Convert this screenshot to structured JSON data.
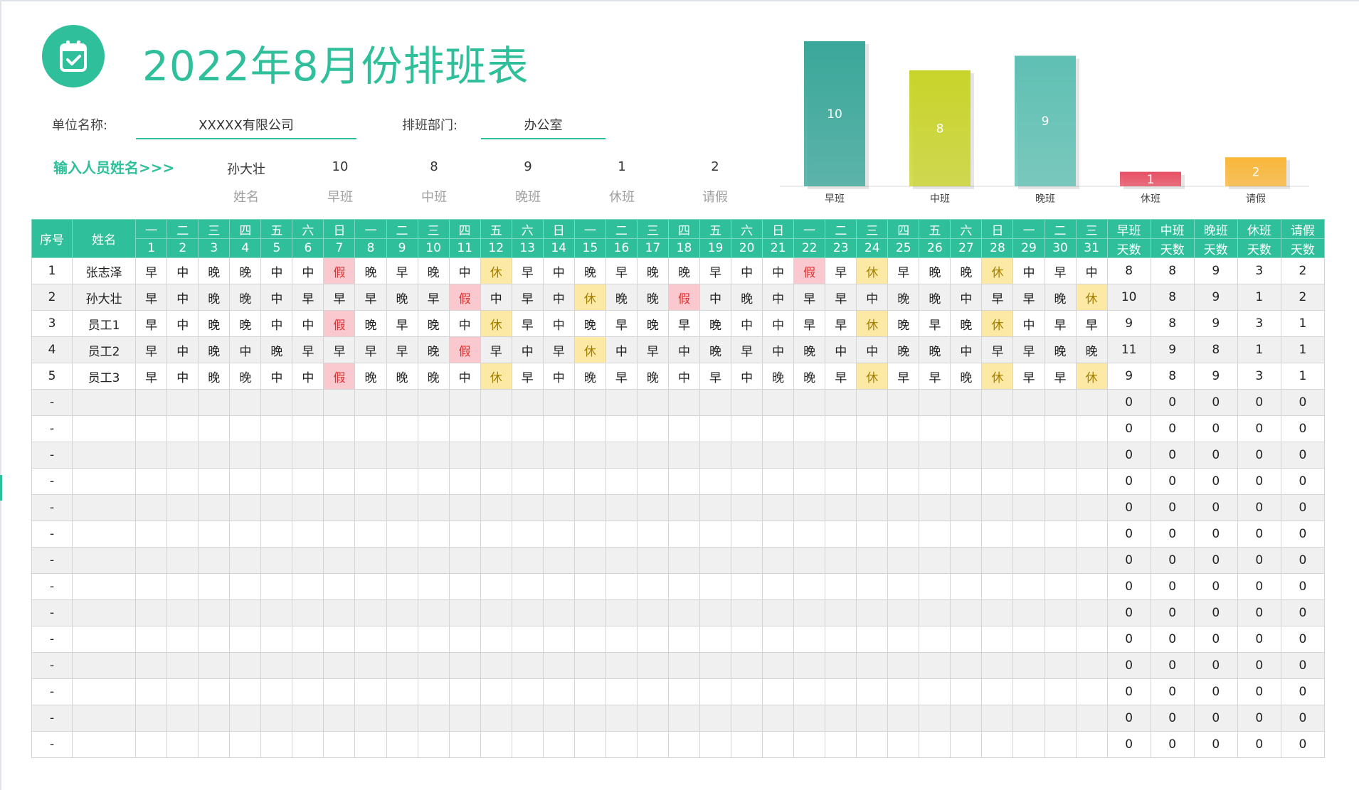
{
  "title": "2022年8月份排班表",
  "company": {
    "label": "单位名称:",
    "value": "XXXXX有限公司"
  },
  "department": {
    "label": "排班部门:",
    "value": "办公室"
  },
  "prompt": "输入人员姓名>>>",
  "summary": {
    "name": "孙大壮",
    "values": [
      "10",
      "8",
      "9",
      "1",
      "2"
    ],
    "labels": [
      "姓名",
      "早班",
      "中班",
      "晚班",
      "休班",
      "请假"
    ]
  },
  "colors": {
    "accent": "#2fbf9a",
    "leave_bg": "#fac9d0",
    "rest_bg": "#fde9a6"
  },
  "chart_data": {
    "type": "bar",
    "categories": [
      "早班",
      "中班",
      "晚班",
      "休班",
      "请假"
    ],
    "values": [
      10,
      8,
      9,
      1,
      2
    ],
    "title": "",
    "xlabel": "",
    "ylabel": "",
    "colors": [
      "#3aa79a",
      "#c9d42a",
      "#5fc0b3",
      "#e85064",
      "#f9b73a"
    ]
  },
  "table": {
    "h_index": "序号",
    "h_name": "姓名",
    "weekdays": [
      "一",
      "二",
      "三",
      "四",
      "五",
      "六",
      "日",
      "一",
      "二",
      "三",
      "四",
      "五",
      "六",
      "日",
      "一",
      "二",
      "三",
      "四",
      "五",
      "六",
      "日",
      "一",
      "二",
      "三",
      "四",
      "五",
      "六",
      "日",
      "一",
      "二",
      "三"
    ],
    "days": [
      "1",
      "2",
      "3",
      "4",
      "5",
      "6",
      "7",
      "8",
      "9",
      "10",
      "11",
      "12",
      "13",
      "14",
      "15",
      "16",
      "17",
      "18",
      "19",
      "20",
      "21",
      "22",
      "23",
      "24",
      "25",
      "26",
      "27",
      "28",
      "29",
      "30",
      "31"
    ],
    "sum_headers": [
      [
        "早班",
        "天数"
      ],
      [
        "中班",
        "天数"
      ],
      [
        "晚班",
        "天数"
      ],
      [
        "休班",
        "天数"
      ],
      [
        "请假",
        "天数"
      ]
    ],
    "rows": [
      {
        "idx": "1",
        "name": "张志泽",
        "shifts": "早中晚晚中中假晚早晚中休早中晚早晚晚早中中假早休早晚晚休中早中",
        "sums": [
          "8",
          "8",
          "9",
          "3",
          "2"
        ]
      },
      {
        "idx": "2",
        "name": "孙大壮",
        "shifts": "早中晚晚中早早早晚早假中早中休晚晚假中晚中早早中晚晚中早早晚休",
        "sums": [
          "10",
          "8",
          "9",
          "1",
          "2"
        ]
      },
      {
        "idx": "3",
        "name": "员工1",
        "shifts": "早中晚晚中中假晚早晚中休早中晚早晚早晚中中早早休晚早晚休中早早",
        "sums": [
          "9",
          "8",
          "9",
          "3",
          "1"
        ]
      },
      {
        "idx": "4",
        "name": "员工2",
        "shifts": "早中晚中晚早早早早晚假早中早休中早中晚早中晚中中晚晚中早早晚晚",
        "sums": [
          "11",
          "9",
          "8",
          "1",
          "1"
        ]
      },
      {
        "idx": "5",
        "name": "员工3",
        "shifts": "早中晚晚中中假晚晚晚中休早中晚早晚中早中晚晚早休早早晚休早早休",
        "sums": [
          "9",
          "8",
          "9",
          "3",
          "1"
        ]
      }
    ],
    "empty_rows": 14,
    "empty_index": "-",
    "empty_sums": [
      "0",
      "0",
      "0",
      "0",
      "0"
    ]
  }
}
